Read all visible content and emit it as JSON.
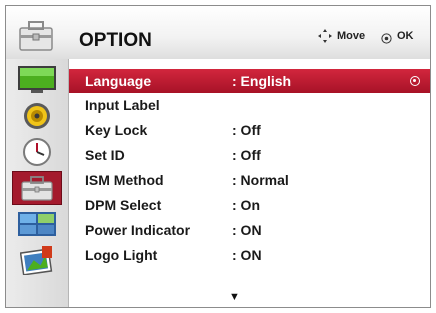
{
  "header": {
    "title": "OPTION",
    "move_label": "Move",
    "ok_label": "OK",
    "icon": "toolbox-icon"
  },
  "categories": [
    {
      "icon": "monitor-picture-icon",
      "selected": false
    },
    {
      "icon": "speaker-audio-icon",
      "selected": false
    },
    {
      "icon": "clock-time-icon",
      "selected": false
    },
    {
      "icon": "toolbox-option-icon",
      "selected": true
    },
    {
      "icon": "multi-screen-icon",
      "selected": false
    },
    {
      "icon": "my-media-icon",
      "selected": false
    }
  ],
  "menu": {
    "items": [
      {
        "label": "Language",
        "value": ": English",
        "selected": true
      },
      {
        "label": "Input Label",
        "value": "",
        "selected": false
      },
      {
        "label": "Key Lock",
        "value": ": Off",
        "selected": false
      },
      {
        "label": "Set ID",
        "value": ": Off",
        "selected": false
      },
      {
        "label": "ISM Method",
        "value": ": Normal",
        "selected": false
      },
      {
        "label": "DPM Select",
        "value": ": On",
        "selected": false
      },
      {
        "label": "Power Indicator",
        "value": ": ON",
        "selected": false
      },
      {
        "label": "Logo Light",
        "value": ": ON",
        "selected": false
      }
    ],
    "more_indicator": "▼"
  },
  "colors": {
    "selection": "#a71227",
    "selection_light": "#d2263d",
    "text": "#1a1a1a",
    "header_bg": "#f2f2f2"
  }
}
